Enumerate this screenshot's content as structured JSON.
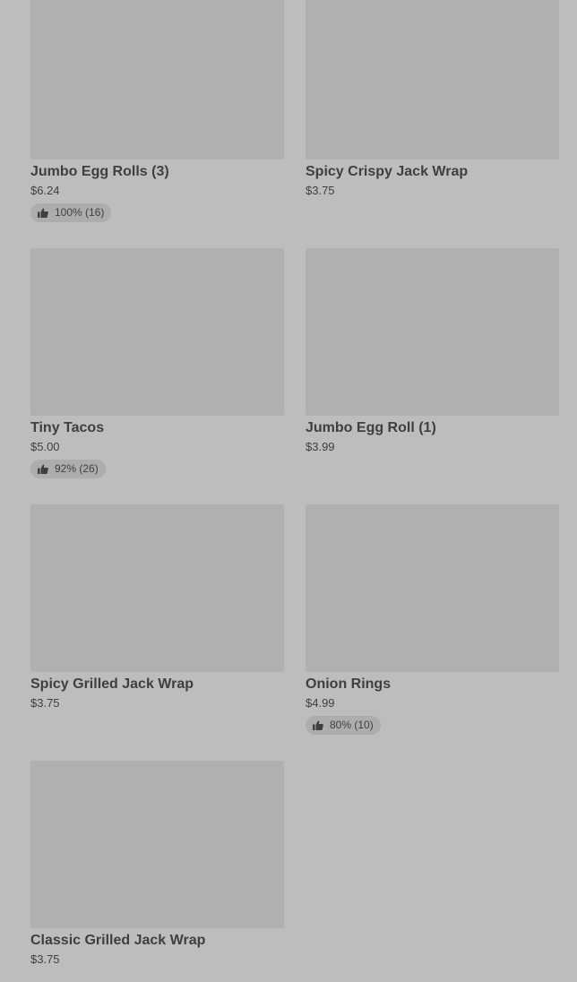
{
  "menu": {
    "items": [
      {
        "name": "Jumbo Egg Rolls (3)",
        "price": "$6.24",
        "rating": "100% (16)"
      },
      {
        "name": "Spicy Crispy Jack Wrap",
        "price": "$3.75"
      },
      {
        "name": "Tiny Tacos",
        "price": "$5.00",
        "rating": "92% (26)"
      },
      {
        "name": "Jumbo Egg Roll (1)",
        "price": "$3.99"
      },
      {
        "name": "Spicy Grilled Jack Wrap",
        "price": "$3.75"
      },
      {
        "name": "Onion Rings",
        "price": "$4.99",
        "rating": "80% (10)"
      },
      {
        "name": "Classic Grilled Jack Wrap",
        "price": "$3.75"
      }
    ]
  },
  "icons": {
    "rating_icon": "thumbs-up-icon"
  }
}
